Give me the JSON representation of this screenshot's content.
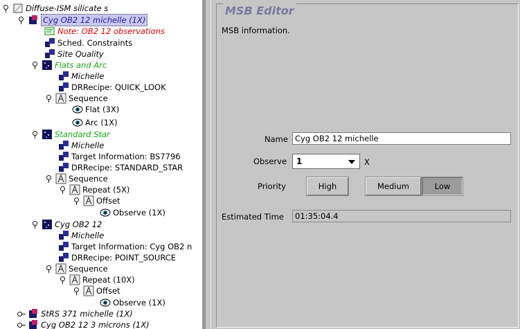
{
  "tree": {
    "root": "Diffuse-ISM silicate s",
    "msb_selected": "Cyg OB2 12 michelle (1X)",
    "note": "Note: OB2 12 observations",
    "sched_constraints": "Sched. Constraints",
    "site_quality": "Site Quality",
    "obs1": {
      "title": "Flats and Arc",
      "instrument": "Michelle",
      "drrecipe": "DRRecipe: QUICK_LOOK",
      "sequence": "Sequence",
      "flat": "Flat (3X)",
      "arc": "Arc (1X)"
    },
    "obs2": {
      "title": "Standard Star",
      "instrument": "Michelle",
      "target": "Target Information: BS7796",
      "drrecipe": "DRRecipe: STANDARD_STAR",
      "sequence": "Sequence",
      "repeat": "Repeat (5X)",
      "offset": "Offset",
      "observe": "Observe (1X)"
    },
    "obs3": {
      "title": "Cyg OB2 12",
      "instrument": "Michelle",
      "target": "Target Information: Cyg OB2 n",
      "drrecipe": "DRRecipe: POINT_SOURCE",
      "sequence": "Sequence",
      "repeat": "Repeat (10X)",
      "offset": "Offset",
      "observe": "Observe (1X)"
    },
    "msb2": "StRS 371 michelle (1X)",
    "msb3": "Cyg OB2 12 3 microns (1X)"
  },
  "editor": {
    "title": "MSB Editor",
    "info": "MSB information.",
    "name_label": "Name",
    "name_value": "Cyg OB2 12 michelle",
    "observe_label": "Observe",
    "observe_value": "1",
    "observe_suffix": "X",
    "priority_label": "Priority",
    "priority_high": "High",
    "priority_medium": "Medium",
    "priority_low": "Low",
    "priority_selected": "Low",
    "est_time_label": "Estimated Time",
    "est_time_value": "01:35:04.4"
  },
  "colors": {
    "note_red": "#e00000",
    "obs_green": "#1aa51a",
    "title_blue": "#7a7aa0",
    "selection": "#c8c8ee"
  }
}
